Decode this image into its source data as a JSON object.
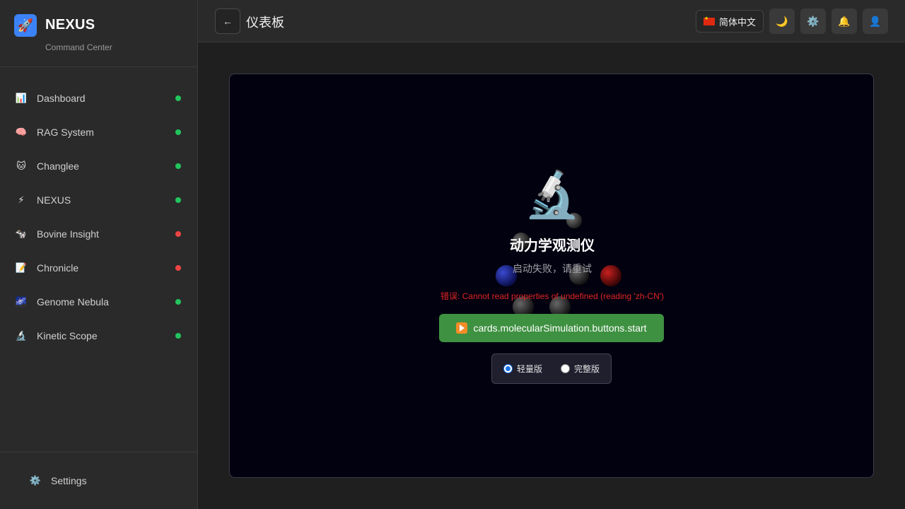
{
  "brand": {
    "name": "NEXUS",
    "subtitle": "Command Center",
    "logo_icon": "🚀"
  },
  "sidebar": {
    "items": [
      {
        "label": "Dashboard",
        "icon": "📊",
        "status": "online",
        "status_color": "#22c55e"
      },
      {
        "label": "RAG System",
        "icon": "🧠",
        "status": "online",
        "status_color": "#22c55e"
      },
      {
        "label": "Changlee",
        "icon": "🐱",
        "status": "online",
        "status_color": "#22c55e"
      },
      {
        "label": "NEXUS",
        "icon": "⚡",
        "status": "online",
        "status_color": "#22c55e"
      },
      {
        "label": "Bovine Insight",
        "icon": "🐄",
        "status": "offline",
        "status_color": "#ef4444"
      },
      {
        "label": "Chronicle",
        "icon": "📝",
        "status": "offline",
        "status_color": "#ef4444"
      },
      {
        "label": "Genome Nebula",
        "icon": "🌌",
        "status": "online",
        "status_color": "#22c55e"
      },
      {
        "label": "Kinetic Scope",
        "icon": "🔬",
        "status": "online",
        "status_color": "#22c55e"
      }
    ],
    "footer": {
      "label": "Settings",
      "icon": "⚙️"
    }
  },
  "header": {
    "back_icon": "←",
    "title": "仪表板",
    "language": "简体中文",
    "theme_icon": "🌙",
    "settings_icon": "⚙️",
    "notifications_icon": "🔔",
    "user_icon": "👤"
  },
  "stage": {
    "icon": "🔬",
    "title": "动力学观测仪",
    "status": "启动失败，请重试",
    "error": "错误: Cannot read properties of undefined (reading 'zh-CN')",
    "start_button": "cards.molecularSimulation.buttons.start",
    "modes": [
      {
        "label": "轻量版",
        "checked": true
      },
      {
        "label": "完整版",
        "checked": false
      }
    ]
  }
}
